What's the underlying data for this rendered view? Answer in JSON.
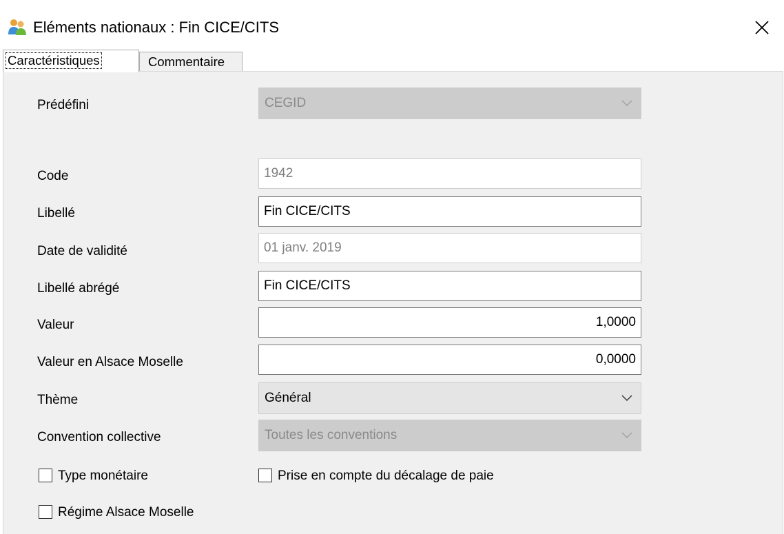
{
  "window": {
    "title": "Eléments nationaux : Fin CICE/CITS",
    "close_glyph": "✕"
  },
  "tabs": [
    {
      "label": "Caractéristiques",
      "active": true
    },
    {
      "label": "Commentaire",
      "active": false
    }
  ],
  "form": {
    "predefini": {
      "label": "Prédéfini",
      "value": "CEGID"
    },
    "code": {
      "label": "Code",
      "value": "1942"
    },
    "libelle": {
      "label": "Libellé",
      "value": "Fin CICE/CITS"
    },
    "date_validite": {
      "label": "Date de validité",
      "value": "01 janv. 2019"
    },
    "libelle_abrege": {
      "label": "Libellé abrégé",
      "value": "Fin CICE/CITS"
    },
    "valeur": {
      "label": "Valeur",
      "value": "1,0000"
    },
    "valeur_alsace": {
      "label": "Valeur en Alsace Moselle",
      "value": "0,0000"
    },
    "theme": {
      "label": "Thème",
      "value": "Général"
    },
    "convention": {
      "label": "Convention collective",
      "value": "Toutes les conventions"
    }
  },
  "checkboxes": {
    "type_monetaire": {
      "label": "Type monétaire",
      "checked": false
    },
    "prise_en_compte": {
      "label": "Prise en compte du décalage de paie",
      "checked": false
    },
    "regime_alsace": {
      "label": "Régime Alsace Moselle",
      "checked": false
    }
  },
  "icons": {
    "app": "people-icon",
    "close": "close-icon",
    "dropdown": "chevron-down-icon"
  },
  "colors": {
    "panel_bg": "#f0f0f0",
    "disabled_combo_bg": "#cccccc",
    "enabled_combo_bg": "#e5e5e5",
    "field_border": "#7a7a7a"
  }
}
